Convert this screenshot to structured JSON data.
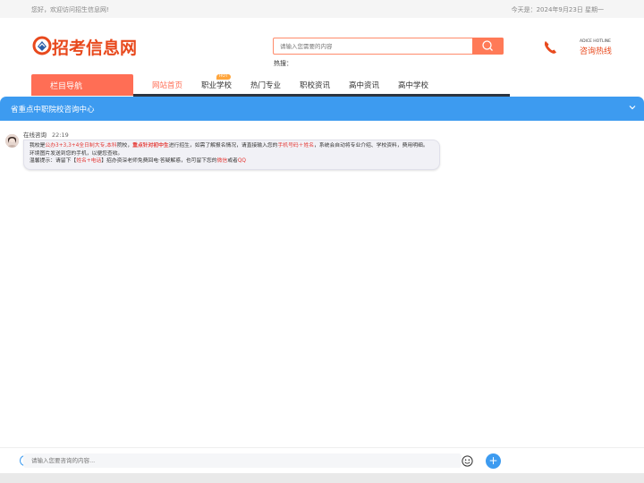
{
  "topbar": {
    "greeting": "您好，欢迎访问招生信息网!",
    "date": "今天是：2024年9月23日 星期一"
  },
  "logo": {
    "text": "招考信息网"
  },
  "search": {
    "placeholder": "请输入您需要的内容",
    "hot_label": "热搜："
  },
  "hotline": {
    "en": "ADICE HOTLINE",
    "cn": "咨询热线"
  },
  "nav": {
    "category_label": "栏目导航",
    "items": [
      "网站首页",
      "职业学校",
      "热门专业",
      "职校资讯",
      "高中资讯",
      "高中学校"
    ],
    "active_index": 0,
    "badge": "HOT"
  },
  "chat": {
    "header_title": "省重点中职院校咨询中心",
    "sender": "在线咨询",
    "time": "22:19",
    "message": {
      "p1": "我校是",
      "r1": "公办3+3,3+4全日制大专,本科",
      "p2": "院校，",
      "s1": "重点针对初中生",
      "p3": "进行招生，如需了解报名情况，请直接输入您的",
      "r2": "手机号码＋姓名",
      "p4": "，系统会自动将专业介绍、学校资料，费用明细。",
      "line2": "环境图片发送到您的手机，以便您查收。",
      "l3a": "温馨提示：请留下【",
      "r3": "姓名+电话",
      "l3b": "】招办资深老师免费回电·答疑解惑，也可留下您的",
      "r4": "微信",
      "l3c": "或者",
      "r5": "QQ"
    },
    "input_placeholder": "请输入您要咨询的内容...",
    "send_symbol": "+"
  },
  "colors": {
    "accent": "#ff6e55",
    "chat_blue": "#3d9bf0",
    "highlight_red": "#e53935"
  }
}
